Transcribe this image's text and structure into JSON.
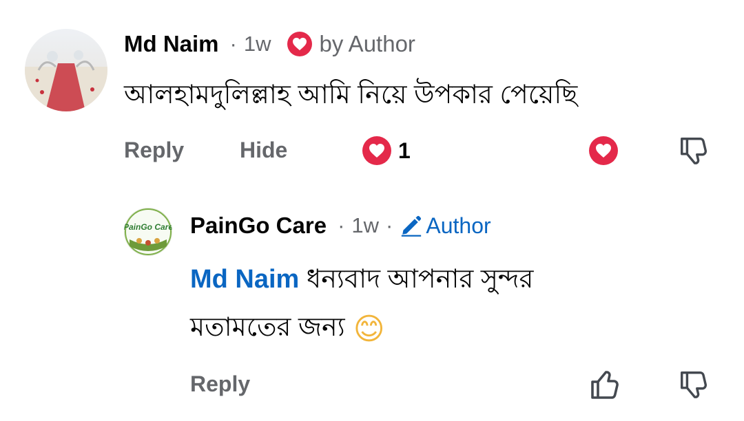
{
  "comment": {
    "author": "Md Naim",
    "sep": "·",
    "time": "1w",
    "loved_by_author": "by Author",
    "text": "আলহামদুলিল্লাহ আমি নিয়ে উপকার পেয়েছি",
    "actions": {
      "reply": "Reply",
      "hide": "Hide"
    },
    "reaction_count": "1"
  },
  "reply": {
    "author": "PainGo Care",
    "sep1": "·",
    "time": "1w",
    "sep2": "·",
    "badge": "Author",
    "avatar_logo": "PainGo Care",
    "mention": "Md Naim",
    "text_line1": "ধন্যবাদ আপনার সুন্দর",
    "text_line2": "মতামতের জন্য",
    "emoji": "😊",
    "actions": {
      "reply": "Reply"
    }
  },
  "icons": {
    "love": "heart-icon",
    "dislike": "thumbs-down-icon",
    "like": "thumbs-up-icon",
    "author_badge": "pencil-icon"
  },
  "colors": {
    "love": "#e4294a",
    "link": "#0a66c2",
    "muted": "#65676b"
  }
}
